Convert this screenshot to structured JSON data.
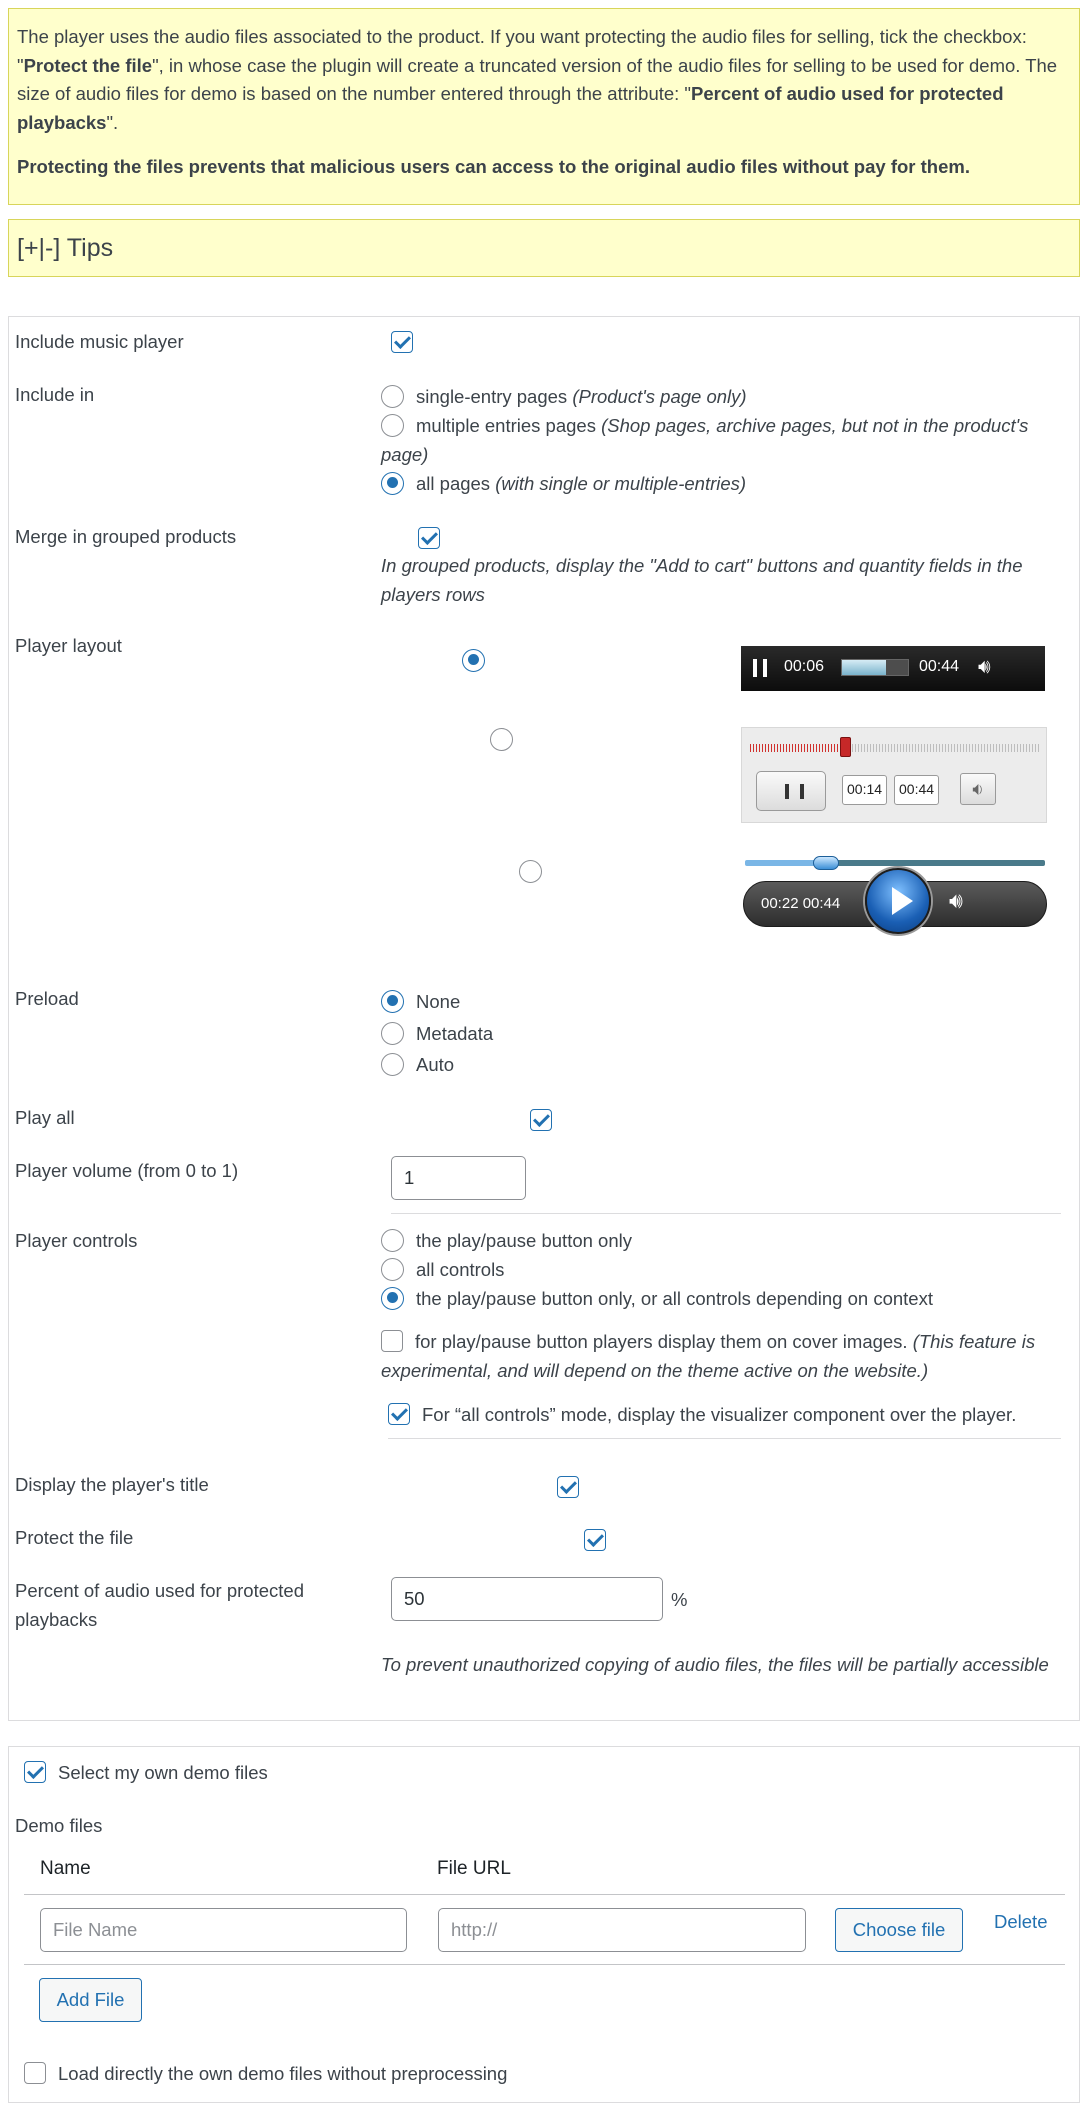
{
  "notice": {
    "intro": "The player uses the audio files associated to the product. If you want protecting the audio files for selling, tick the checkbox: \"",
    "protect_term": "Protect the file",
    "mid": "\", in whose case the plugin will create a truncated version of the audio files for selling to be used for demo. The size of audio files for demo is based on the number entered through the attribute: \"",
    "percent_term": "Percent of audio used for protected playbacks",
    "end": "\".",
    "warning": "Protecting the files prevents that malicious users can access to the original audio files without pay for them."
  },
  "tips": {
    "label": "[+|-] Tips"
  },
  "settings": {
    "include_player": {
      "label": "Include music player",
      "checked": true
    },
    "include_in": {
      "label": "Include in",
      "options": [
        {
          "text": "single-entry pages",
          "hint": "(Product's page only)",
          "checked": false
        },
        {
          "text": "multiple entries pages",
          "hint": "(Shop pages, archive pages, but not in the product's page)",
          "checked": false
        },
        {
          "text": "all pages",
          "hint": "(with single or multiple-entries)",
          "checked": true
        }
      ]
    },
    "merge_grouped": {
      "label": "Merge in grouped products",
      "checked": true,
      "hint": "In grouped products, display the \"Add to cart\" buttons and quantity fields in the players rows"
    },
    "player_layout": {
      "label": "Player layout",
      "selected_index": 0,
      "skin1": {
        "current": "00:06",
        "duration": "00:44",
        "progress": 0.66
      },
      "skin2": {
        "current": "00:14",
        "duration": "00:44",
        "progress": 0.33
      },
      "skin3": {
        "current": "00:22",
        "duration": "00:44",
        "progress": 0.27
      }
    },
    "preload": {
      "label": "Preload",
      "options": [
        {
          "text": "None",
          "checked": true
        },
        {
          "text": "Metadata",
          "checked": false
        },
        {
          "text": "Auto",
          "checked": false
        }
      ]
    },
    "play_all": {
      "label": "Play all",
      "checked": true
    },
    "volume": {
      "label": "Player volume (from 0 to 1)",
      "value": "1"
    },
    "controls": {
      "label": "Player controls",
      "options": [
        {
          "text": "the play/pause button only",
          "checked": false
        },
        {
          "text": "all controls",
          "checked": false
        },
        {
          "text": "the play/pause button only, or all controls depending on context",
          "checked": true
        }
      ],
      "cover_images": {
        "text": "for play/pause button players display them on cover images.",
        "hint": "(This feature is experimental, and will depend on the theme active on the website.)",
        "checked": false
      },
      "visualizer": {
        "text": "For “all controls” mode, display the visualizer component over the player.",
        "checked": true
      }
    },
    "display_title": {
      "label": "Display the player's title",
      "checked": true
    },
    "protect_file": {
      "label": "Protect the file",
      "checked": true
    },
    "percent": {
      "label": "Percent of audio used for protected playbacks",
      "value": "50",
      "unit": "%",
      "hint": "To prevent unauthorized copying of audio files, the files will be partially accessible"
    }
  },
  "demo": {
    "select_own": {
      "label": "Select my own demo files",
      "checked": true
    },
    "section_label": "Demo files",
    "columns": {
      "name": "Name",
      "url": "File URL"
    },
    "row": {
      "name_placeholder": "File Name",
      "url_placeholder": "http://",
      "choose_label": "Choose file",
      "delete_label": "Delete"
    },
    "add_label": "Add File",
    "load_directly": {
      "label": "Load directly the own demo files without preprocessing",
      "checked": false
    }
  },
  "colors": {
    "accent": "#2271b1",
    "notice_bg": "#ffffcc",
    "notice_border": "#d8d55a",
    "border": "#dcdcde"
  }
}
